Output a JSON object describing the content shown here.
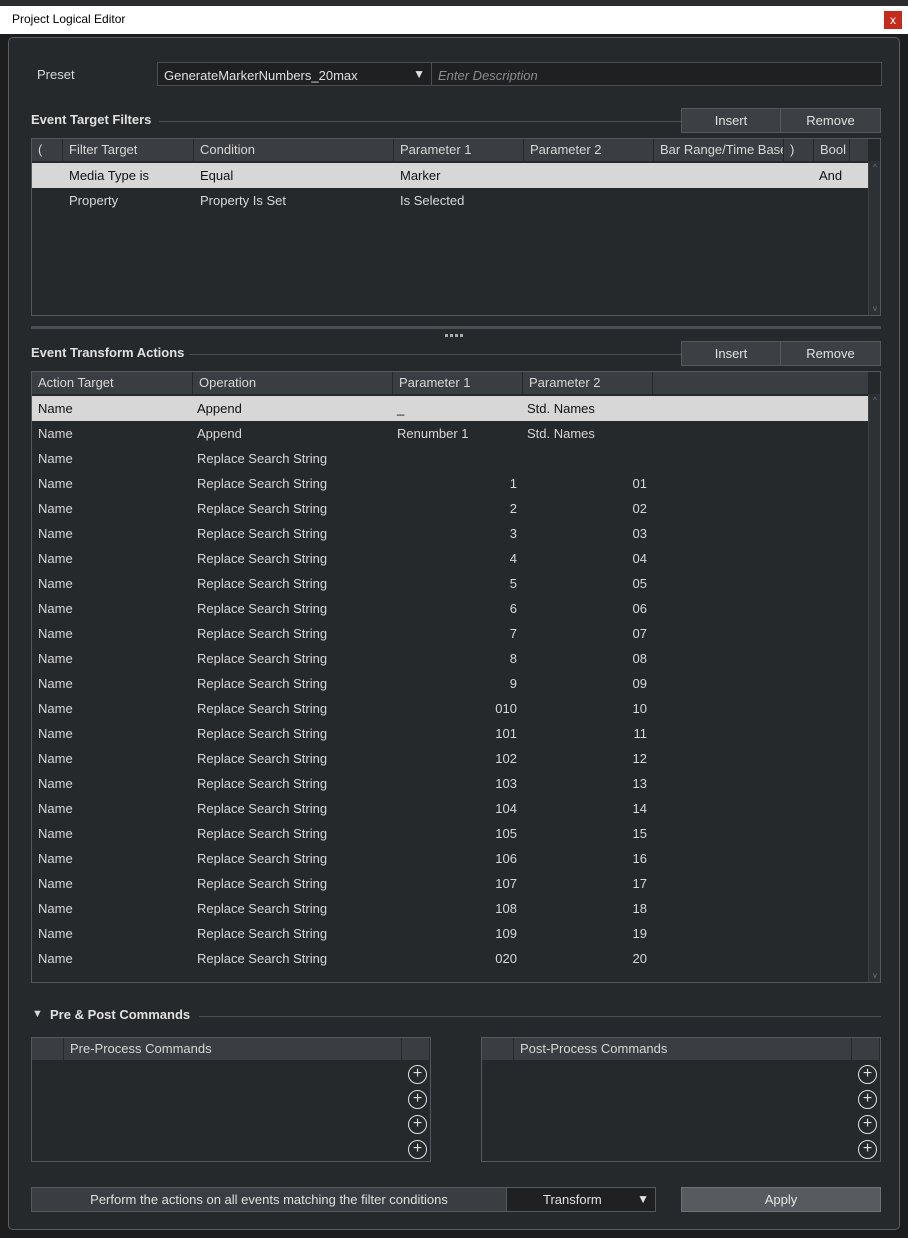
{
  "window": {
    "title": "Project Logical Editor",
    "close_glyph": "x"
  },
  "preset": {
    "label": "Preset",
    "value": "GenerateMarkerNumbers_20max",
    "description_placeholder": "Enter Description"
  },
  "filters": {
    "title": "Event Target Filters",
    "insert_label": "Insert",
    "remove_label": "Remove",
    "columns": [
      "(",
      "Filter Target",
      "Condition",
      "Parameter 1",
      "Parameter 2",
      "Bar Range/Time Base",
      ")",
      "Bool"
    ],
    "rows": [
      {
        "target": "Media Type is",
        "condition": "Equal",
        "param1": "Marker",
        "param2": "",
        "bool": "And"
      },
      {
        "target": "Property",
        "condition": "Property Is Set",
        "param1": "Is Selected",
        "param2": "",
        "bool": ""
      }
    ]
  },
  "actions": {
    "title": "Event Transform Actions",
    "insert_label": "Insert",
    "remove_label": "Remove",
    "columns": [
      "Action Target",
      "Operation",
      "Parameter 1",
      "Parameter 2"
    ],
    "rows": [
      {
        "target": "Name",
        "operation": "Append",
        "param1": "_",
        "param2": "Std. Names",
        "align": "left"
      },
      {
        "target": "Name",
        "operation": "Append",
        "param1": "Renumber 1",
        "param2": "Std. Names",
        "align": "left"
      },
      {
        "target": "Name",
        "operation": "Replace Search String",
        "param1": "",
        "param2": "",
        "align": "right"
      },
      {
        "target": "Name",
        "operation": "Replace Search String",
        "param1": "1",
        "param2": "01",
        "align": "right"
      },
      {
        "target": "Name",
        "operation": "Replace Search String",
        "param1": "2",
        "param2": "02",
        "align": "right"
      },
      {
        "target": "Name",
        "operation": "Replace Search String",
        "param1": "3",
        "param2": "03",
        "align": "right"
      },
      {
        "target": "Name",
        "operation": "Replace Search String",
        "param1": "4",
        "param2": "04",
        "align": "right"
      },
      {
        "target": "Name",
        "operation": "Replace Search String",
        "param1": "5",
        "param2": "05",
        "align": "right"
      },
      {
        "target": "Name",
        "operation": "Replace Search String",
        "param1": "6",
        "param2": "06",
        "align": "right"
      },
      {
        "target": "Name",
        "operation": "Replace Search String",
        "param1": "7",
        "param2": "07",
        "align": "right"
      },
      {
        "target": "Name",
        "operation": "Replace Search String",
        "param1": "8",
        "param2": "08",
        "align": "right"
      },
      {
        "target": "Name",
        "operation": "Replace Search String",
        "param1": "9",
        "param2": "09",
        "align": "right"
      },
      {
        "target": "Name",
        "operation": "Replace Search String",
        "param1": "010",
        "param2": "10",
        "align": "right"
      },
      {
        "target": "Name",
        "operation": "Replace Search String",
        "param1": "101",
        "param2": "11",
        "align": "right"
      },
      {
        "target": "Name",
        "operation": "Replace Search String",
        "param1": "102",
        "param2": "12",
        "align": "right"
      },
      {
        "target": "Name",
        "operation": "Replace Search String",
        "param1": "103",
        "param2": "13",
        "align": "right"
      },
      {
        "target": "Name",
        "operation": "Replace Search String",
        "param1": "104",
        "param2": "14",
        "align": "right"
      },
      {
        "target": "Name",
        "operation": "Replace Search String",
        "param1": "105",
        "param2": "15",
        "align": "right"
      },
      {
        "target": "Name",
        "operation": "Replace Search String",
        "param1": "106",
        "param2": "16",
        "align": "right"
      },
      {
        "target": "Name",
        "operation": "Replace Search String",
        "param1": "107",
        "param2": "17",
        "align": "right"
      },
      {
        "target": "Name",
        "operation": "Replace Search String",
        "param1": "108",
        "param2": "18",
        "align": "right"
      },
      {
        "target": "Name",
        "operation": "Replace Search String",
        "param1": "109",
        "param2": "19",
        "align": "right"
      },
      {
        "target": "Name",
        "operation": "Replace Search String",
        "param1": "020",
        "param2": "20",
        "align": "right"
      }
    ]
  },
  "commands": {
    "title": "Pre & Post Commands",
    "toggle_glyph": "▼",
    "pre_header": "Pre-Process Commands",
    "post_header": "Post-Process Commands",
    "add_glyph": "+"
  },
  "footer": {
    "perform_text": "Perform the actions on all events matching the filter conditions",
    "function_value": "Transform",
    "apply_label": "Apply"
  },
  "icons": {
    "dropdown": "chevron-down-icon",
    "close": "close-icon",
    "add": "plus-circle-icon",
    "toggle": "triangle-down-icon"
  },
  "colors": {
    "background": "#26292c",
    "selected_row": "#d7d7d7",
    "header": "#3a3d41",
    "close_button": "#c42b1c"
  }
}
